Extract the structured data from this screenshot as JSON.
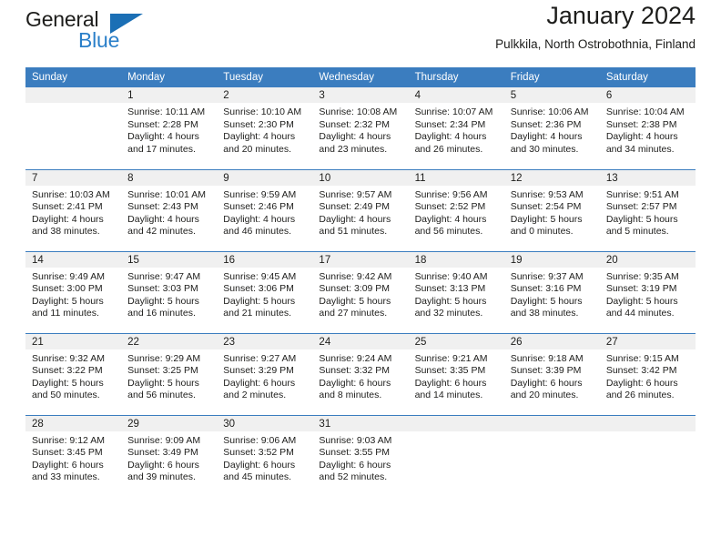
{
  "brand": {
    "word_general": "General",
    "word_blue": "Blue",
    "triangle_color": "#1b6fb5"
  },
  "header": {
    "title": "January 2024",
    "subtitle": "Pulkkila, North Ostrobothnia, Finland"
  },
  "theme": {
    "header_row_bg": "#3b7dbf",
    "daynum_band_bg": "#f0f0f0",
    "text_color": "#1d1d1b"
  },
  "weekday_headers": [
    "Sunday",
    "Monday",
    "Tuesday",
    "Wednesday",
    "Thursday",
    "Friday",
    "Saturday"
  ],
  "weeks": [
    [
      {
        "day": "",
        "sunrise": "",
        "sunset": "",
        "daylight_line1": "",
        "daylight_line2": ""
      },
      {
        "day": "1",
        "sunrise": "Sunrise: 10:11 AM",
        "sunset": "Sunset: 2:28 PM",
        "daylight_line1": "Daylight: 4 hours",
        "daylight_line2": "and 17 minutes."
      },
      {
        "day": "2",
        "sunrise": "Sunrise: 10:10 AM",
        "sunset": "Sunset: 2:30 PM",
        "daylight_line1": "Daylight: 4 hours",
        "daylight_line2": "and 20 minutes."
      },
      {
        "day": "3",
        "sunrise": "Sunrise: 10:08 AM",
        "sunset": "Sunset: 2:32 PM",
        "daylight_line1": "Daylight: 4 hours",
        "daylight_line2": "and 23 minutes."
      },
      {
        "day": "4",
        "sunrise": "Sunrise: 10:07 AM",
        "sunset": "Sunset: 2:34 PM",
        "daylight_line1": "Daylight: 4 hours",
        "daylight_line2": "and 26 minutes."
      },
      {
        "day": "5",
        "sunrise": "Sunrise: 10:06 AM",
        "sunset": "Sunset: 2:36 PM",
        "daylight_line1": "Daylight: 4 hours",
        "daylight_line2": "and 30 minutes."
      },
      {
        "day": "6",
        "sunrise": "Sunrise: 10:04 AM",
        "sunset": "Sunset: 2:38 PM",
        "daylight_line1": "Daylight: 4 hours",
        "daylight_line2": "and 34 minutes."
      }
    ],
    [
      {
        "day": "7",
        "sunrise": "Sunrise: 10:03 AM",
        "sunset": "Sunset: 2:41 PM",
        "daylight_line1": "Daylight: 4 hours",
        "daylight_line2": "and 38 minutes."
      },
      {
        "day": "8",
        "sunrise": "Sunrise: 10:01 AM",
        "sunset": "Sunset: 2:43 PM",
        "daylight_line1": "Daylight: 4 hours",
        "daylight_line2": "and 42 minutes."
      },
      {
        "day": "9",
        "sunrise": "Sunrise: 9:59 AM",
        "sunset": "Sunset: 2:46 PM",
        "daylight_line1": "Daylight: 4 hours",
        "daylight_line2": "and 46 minutes."
      },
      {
        "day": "10",
        "sunrise": "Sunrise: 9:57 AM",
        "sunset": "Sunset: 2:49 PM",
        "daylight_line1": "Daylight: 4 hours",
        "daylight_line2": "and 51 minutes."
      },
      {
        "day": "11",
        "sunrise": "Sunrise: 9:56 AM",
        "sunset": "Sunset: 2:52 PM",
        "daylight_line1": "Daylight: 4 hours",
        "daylight_line2": "and 56 minutes."
      },
      {
        "day": "12",
        "sunrise": "Sunrise: 9:53 AM",
        "sunset": "Sunset: 2:54 PM",
        "daylight_line1": "Daylight: 5 hours",
        "daylight_line2": "and 0 minutes."
      },
      {
        "day": "13",
        "sunrise": "Sunrise: 9:51 AM",
        "sunset": "Sunset: 2:57 PM",
        "daylight_line1": "Daylight: 5 hours",
        "daylight_line2": "and 5 minutes."
      }
    ],
    [
      {
        "day": "14",
        "sunrise": "Sunrise: 9:49 AM",
        "sunset": "Sunset: 3:00 PM",
        "daylight_line1": "Daylight: 5 hours",
        "daylight_line2": "and 11 minutes."
      },
      {
        "day": "15",
        "sunrise": "Sunrise: 9:47 AM",
        "sunset": "Sunset: 3:03 PM",
        "daylight_line1": "Daylight: 5 hours",
        "daylight_line2": "and 16 minutes."
      },
      {
        "day": "16",
        "sunrise": "Sunrise: 9:45 AM",
        "sunset": "Sunset: 3:06 PM",
        "daylight_line1": "Daylight: 5 hours",
        "daylight_line2": "and 21 minutes."
      },
      {
        "day": "17",
        "sunrise": "Sunrise: 9:42 AM",
        "sunset": "Sunset: 3:09 PM",
        "daylight_line1": "Daylight: 5 hours",
        "daylight_line2": "and 27 minutes."
      },
      {
        "day": "18",
        "sunrise": "Sunrise: 9:40 AM",
        "sunset": "Sunset: 3:13 PM",
        "daylight_line1": "Daylight: 5 hours",
        "daylight_line2": "and 32 minutes."
      },
      {
        "day": "19",
        "sunrise": "Sunrise: 9:37 AM",
        "sunset": "Sunset: 3:16 PM",
        "daylight_line1": "Daylight: 5 hours",
        "daylight_line2": "and 38 minutes."
      },
      {
        "day": "20",
        "sunrise": "Sunrise: 9:35 AM",
        "sunset": "Sunset: 3:19 PM",
        "daylight_line1": "Daylight: 5 hours",
        "daylight_line2": "and 44 minutes."
      }
    ],
    [
      {
        "day": "21",
        "sunrise": "Sunrise: 9:32 AM",
        "sunset": "Sunset: 3:22 PM",
        "daylight_line1": "Daylight: 5 hours",
        "daylight_line2": "and 50 minutes."
      },
      {
        "day": "22",
        "sunrise": "Sunrise: 9:29 AM",
        "sunset": "Sunset: 3:25 PM",
        "daylight_line1": "Daylight: 5 hours",
        "daylight_line2": "and 56 minutes."
      },
      {
        "day": "23",
        "sunrise": "Sunrise: 9:27 AM",
        "sunset": "Sunset: 3:29 PM",
        "daylight_line1": "Daylight: 6 hours",
        "daylight_line2": "and 2 minutes."
      },
      {
        "day": "24",
        "sunrise": "Sunrise: 9:24 AM",
        "sunset": "Sunset: 3:32 PM",
        "daylight_line1": "Daylight: 6 hours",
        "daylight_line2": "and 8 minutes."
      },
      {
        "day": "25",
        "sunrise": "Sunrise: 9:21 AM",
        "sunset": "Sunset: 3:35 PM",
        "daylight_line1": "Daylight: 6 hours",
        "daylight_line2": "and 14 minutes."
      },
      {
        "day": "26",
        "sunrise": "Sunrise: 9:18 AM",
        "sunset": "Sunset: 3:39 PM",
        "daylight_line1": "Daylight: 6 hours",
        "daylight_line2": "and 20 minutes."
      },
      {
        "day": "27",
        "sunrise": "Sunrise: 9:15 AM",
        "sunset": "Sunset: 3:42 PM",
        "daylight_line1": "Daylight: 6 hours",
        "daylight_line2": "and 26 minutes."
      }
    ],
    [
      {
        "day": "28",
        "sunrise": "Sunrise: 9:12 AM",
        "sunset": "Sunset: 3:45 PM",
        "daylight_line1": "Daylight: 6 hours",
        "daylight_line2": "and 33 minutes."
      },
      {
        "day": "29",
        "sunrise": "Sunrise: 9:09 AM",
        "sunset": "Sunset: 3:49 PM",
        "daylight_line1": "Daylight: 6 hours",
        "daylight_line2": "and 39 minutes."
      },
      {
        "day": "30",
        "sunrise": "Sunrise: 9:06 AM",
        "sunset": "Sunset: 3:52 PM",
        "daylight_line1": "Daylight: 6 hours",
        "daylight_line2": "and 45 minutes."
      },
      {
        "day": "31",
        "sunrise": "Sunrise: 9:03 AM",
        "sunset": "Sunset: 3:55 PM",
        "daylight_line1": "Daylight: 6 hours",
        "daylight_line2": "and 52 minutes."
      },
      {
        "day": "",
        "sunrise": "",
        "sunset": "",
        "daylight_line1": "",
        "daylight_line2": ""
      },
      {
        "day": "",
        "sunrise": "",
        "sunset": "",
        "daylight_line1": "",
        "daylight_line2": ""
      },
      {
        "day": "",
        "sunrise": "",
        "sunset": "",
        "daylight_line1": "",
        "daylight_line2": ""
      }
    ]
  ]
}
